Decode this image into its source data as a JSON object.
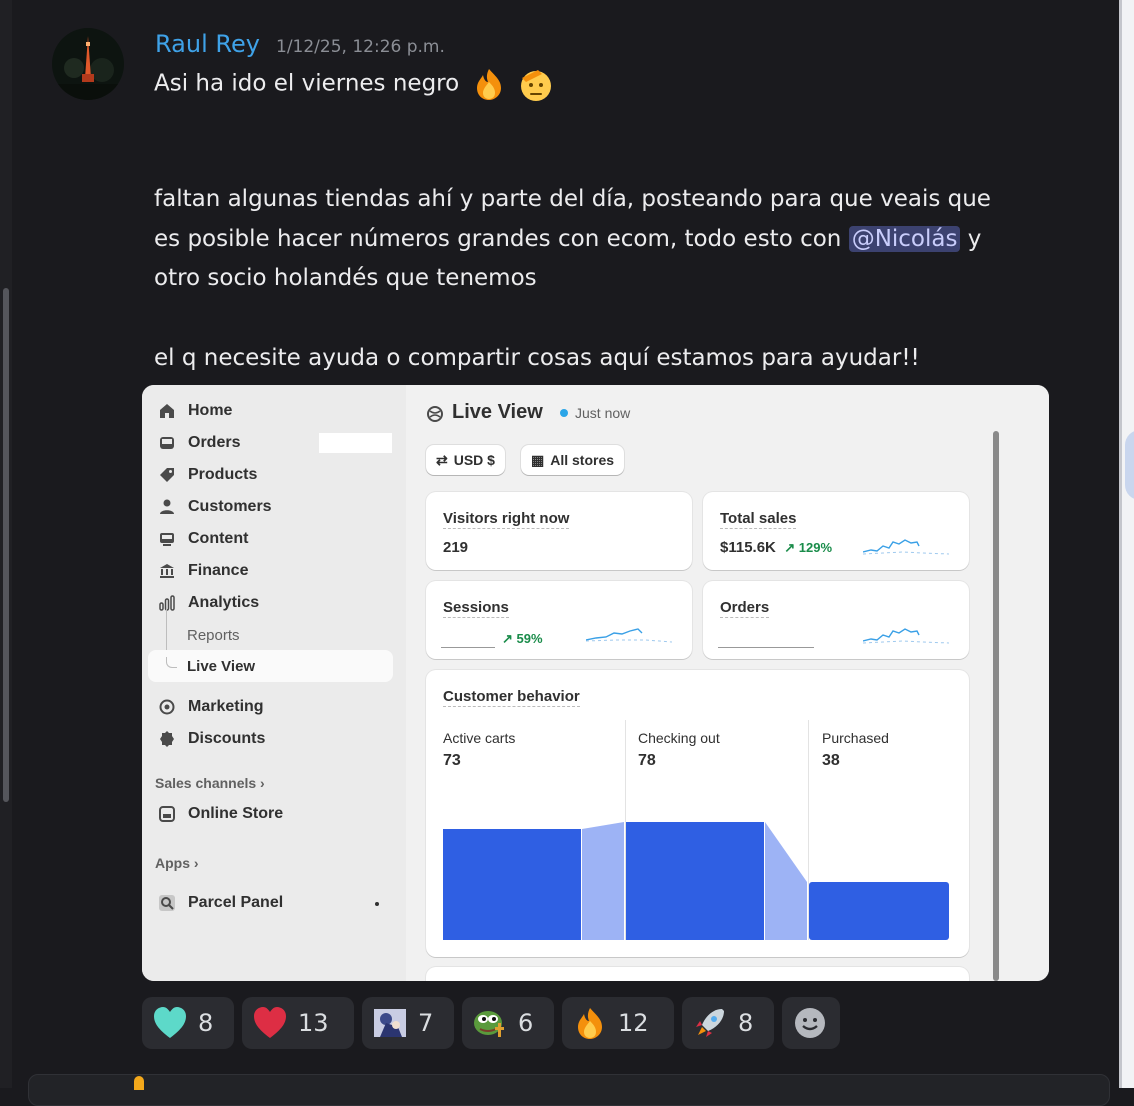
{
  "message": {
    "author": "Raul Rey",
    "timestamp": "1/12/25, 12:26 p.m.",
    "line1": "Asi ha ido el viernes negro",
    "line2": "faltan algunas tiendas ahí y parte del día, posteando para que veais que",
    "line3_pre": "es posible hacer números grandes con ecom, todo esto con ",
    "mention": "@Nicolás",
    "line3_post": " y",
    "line4": "otro socio holandés que tenemos",
    "line5": "el q necesite ayuda o compartir cosas aquí estamos para ayudar!!"
  },
  "screenshot": {
    "sidebar": {
      "items": [
        "Home",
        "Orders",
        "Products",
        "Customers",
        "Content",
        "Finance",
        "Analytics"
      ],
      "sub_reports": "Reports",
      "sub_live_view": "Live View",
      "items2": [
        "Marketing",
        "Discounts"
      ],
      "sales_channels": "Sales channels",
      "online_store": "Online Store",
      "apps": "Apps",
      "parcel_panel": "Parcel Panel"
    },
    "header": {
      "title": "Live View",
      "status": "Just now"
    },
    "pills": {
      "currency": "USD $",
      "stores": "All stores"
    },
    "visitors": {
      "label": "Visitors right now",
      "value": "219"
    },
    "total_sales": {
      "label": "Total sales",
      "value": "$115.6K",
      "change": "129%"
    },
    "sessions": {
      "label": "Sessions",
      "change": "59%"
    },
    "orders": {
      "label": "Orders"
    },
    "behavior": {
      "title": "Customer behavior",
      "active_label": "Active carts",
      "active_value": "73",
      "checkout_label": "Checking out",
      "checkout_value": "78",
      "purchased_label": "Purchased",
      "purchased_value": "38"
    }
  },
  "reactions": [
    {
      "icon": "teal-heart-icon",
      "count": "8"
    },
    {
      "icon": "red-heart-icon",
      "count": "13"
    },
    {
      "icon": "custom-emoji-icon",
      "count": "7"
    },
    {
      "icon": "pepe-emoji-icon",
      "count": "6"
    },
    {
      "icon": "fire-icon",
      "count": "12"
    },
    {
      "icon": "rocket-icon",
      "count": "8"
    }
  ],
  "colors": {
    "username": "#3fa2e8",
    "mention_bg": "#3c4270",
    "bar": "#2f5fe3",
    "bar_light": "#9db3f5"
  }
}
